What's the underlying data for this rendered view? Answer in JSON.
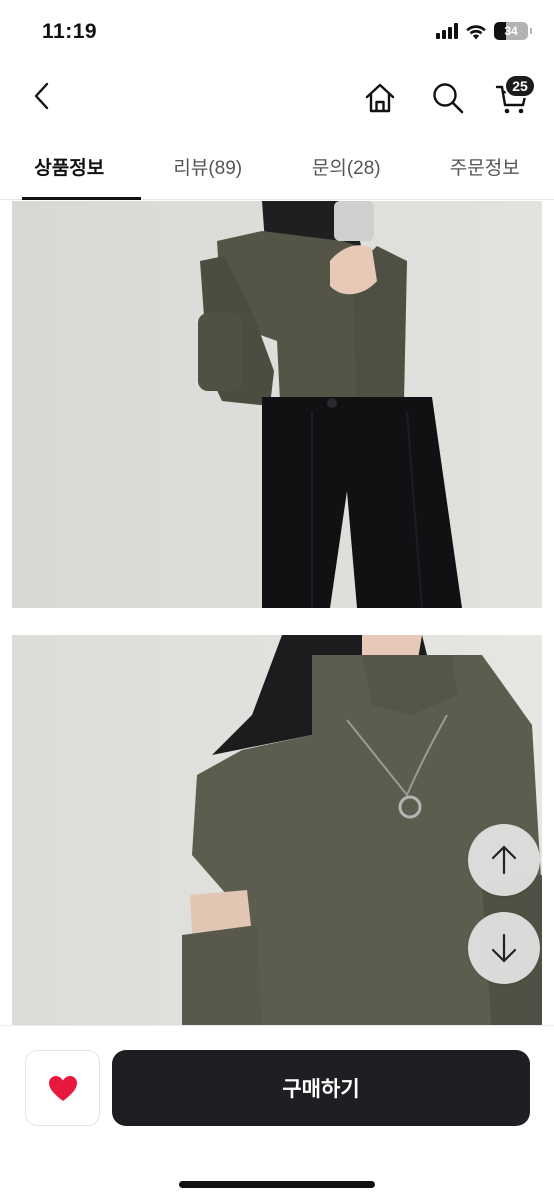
{
  "status_bar": {
    "time": "11:19",
    "battery_level": "34"
  },
  "nav": {
    "back_icon": "chevron-left-icon",
    "home_icon": "home-icon",
    "search_icon": "search-icon",
    "cart_icon": "cart-icon",
    "cart_count": "25"
  },
  "tabs": [
    {
      "label": "상품정보",
      "active": true
    },
    {
      "label": "리뷰(89)",
      "active": false
    },
    {
      "label": "문의(28)",
      "active": false
    },
    {
      "label": "주문정보",
      "active": false
    }
  ],
  "floating": {
    "scroll_up_icon": "arrow-up-icon",
    "scroll_down_icon": "arrow-down-icon"
  },
  "bottom_bar": {
    "like_icon": "heart-icon",
    "like_color": "#e8193c",
    "buy_label": "구매하기",
    "buy_bg": "#1e1f22"
  }
}
